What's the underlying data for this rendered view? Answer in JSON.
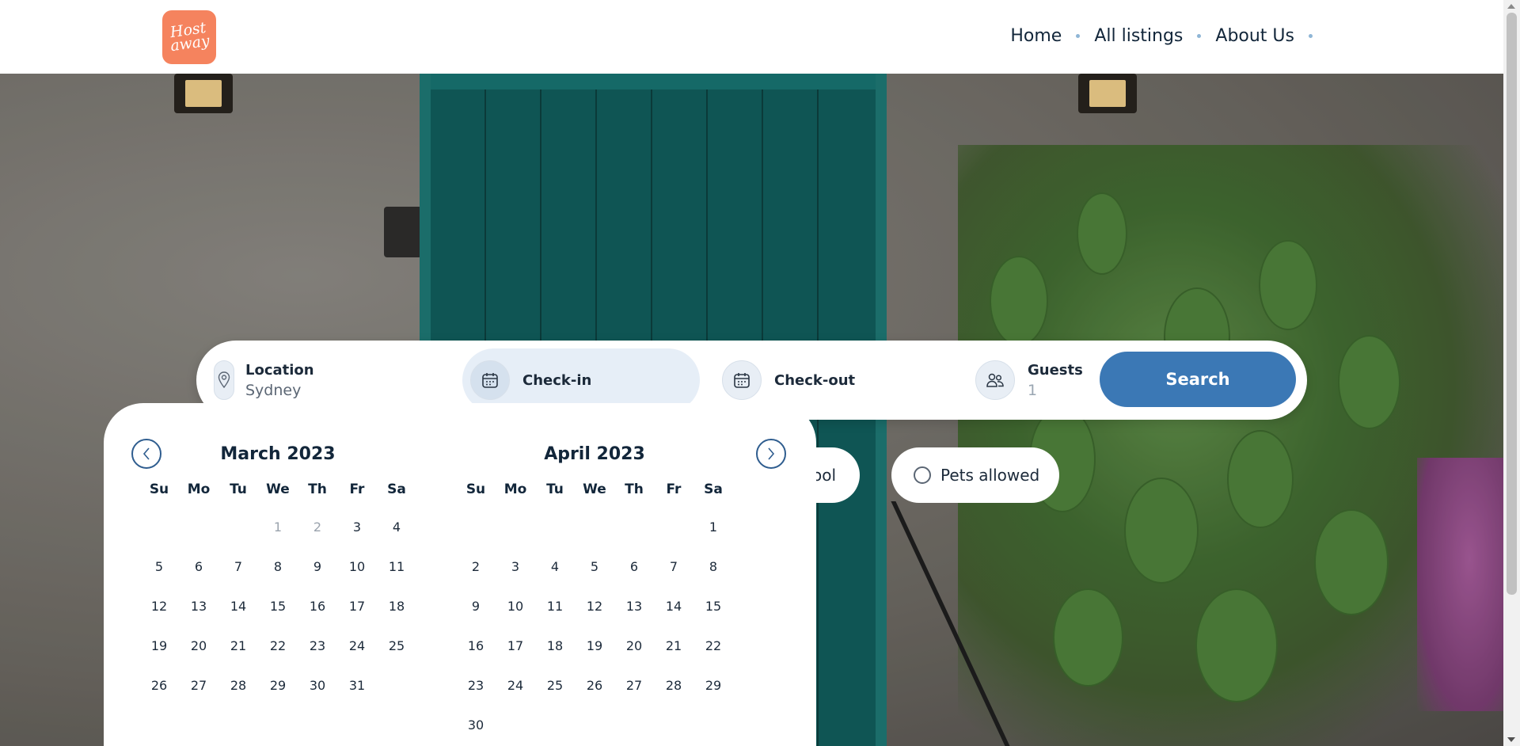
{
  "header": {
    "logo_text": "Host\naway",
    "nav": [
      {
        "label": "Home"
      },
      {
        "label": "All listings"
      },
      {
        "label": "About Us"
      }
    ]
  },
  "search": {
    "location_label": "Location",
    "location_value": "Sydney",
    "checkin_label": "Check-in",
    "checkout_label": "Check-out",
    "guests_label": "Guests",
    "guests_value": "1",
    "search_button": "Search"
  },
  "filters": {
    "pool_label_partial": "ool",
    "pets_label": "Pets allowed"
  },
  "calendar": {
    "weekdays": [
      "Su",
      "Mo",
      "Tu",
      "We",
      "Th",
      "Fr",
      "Sa"
    ],
    "months": [
      {
        "title": "March 2023",
        "leading_blanks": 3,
        "days": [
          "1",
          "2",
          "3",
          "4",
          "5",
          "6",
          "7",
          "8",
          "9",
          "10",
          "11",
          "12",
          "13",
          "14",
          "15",
          "16",
          "17",
          "18",
          "19",
          "20",
          "21",
          "22",
          "23",
          "24",
          "25",
          "26",
          "27",
          "28",
          "29",
          "30",
          "31"
        ],
        "disabled_days": [
          "1",
          "2"
        ]
      },
      {
        "title": "April 2023",
        "leading_blanks": 6,
        "days": [
          "1",
          "2",
          "3",
          "4",
          "5",
          "6",
          "7",
          "8",
          "9",
          "10",
          "11",
          "12",
          "13",
          "14",
          "15",
          "16",
          "17",
          "18",
          "19",
          "20",
          "21",
          "22",
          "23",
          "24",
          "25",
          "26",
          "27",
          "28",
          "29",
          "30"
        ],
        "disabled_days": []
      }
    ]
  },
  "colors": {
    "accent": "#3b78b5",
    "logo": "#f5835e",
    "nav_dot": "#8fb6d6"
  },
  "icons": {
    "location": "map-pin-icon",
    "checkin": "calendar-icon",
    "checkout": "calendar-icon",
    "guests": "users-icon",
    "prev": "chevron-left-icon",
    "next": "chevron-right-icon"
  }
}
